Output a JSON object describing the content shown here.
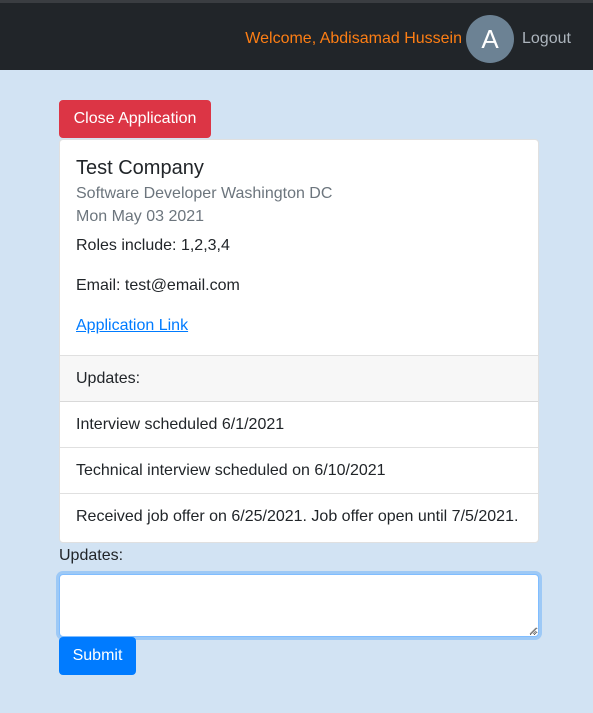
{
  "header": {
    "welcome_text": "Welcome, Abdisamad Hussein",
    "avatar_initial": "A",
    "logout_label": "Logout"
  },
  "actions": {
    "close_label": "Close Application",
    "submit_label": "Submit"
  },
  "application": {
    "company": "Test Company",
    "position_location": "Software Developer Washington DC",
    "date": "Mon May 03 2021",
    "roles": "Roles include: 1,2,3,4",
    "email": "Email: test@email.com",
    "link_label": "Application Link"
  },
  "updates": {
    "header": "Updates:",
    "items": [
      "Interview scheduled 6/1/2021",
      "Technical interview scheduled on 6/10/2021",
      "Received job offer on 6/25/2021. Job offer open until 7/5/2021."
    ]
  },
  "form": {
    "updates_label": "Updates:",
    "updates_value": ""
  },
  "colors": {
    "page_bg": "#d2e3f3",
    "navbar_bg": "#212529",
    "welcome": "#fd7e14",
    "danger": "#dc3545",
    "primary": "#007bff"
  },
  "icons": {
    "avatar": "avatar-circle",
    "textarea_resize": "resize-grip-icon"
  }
}
